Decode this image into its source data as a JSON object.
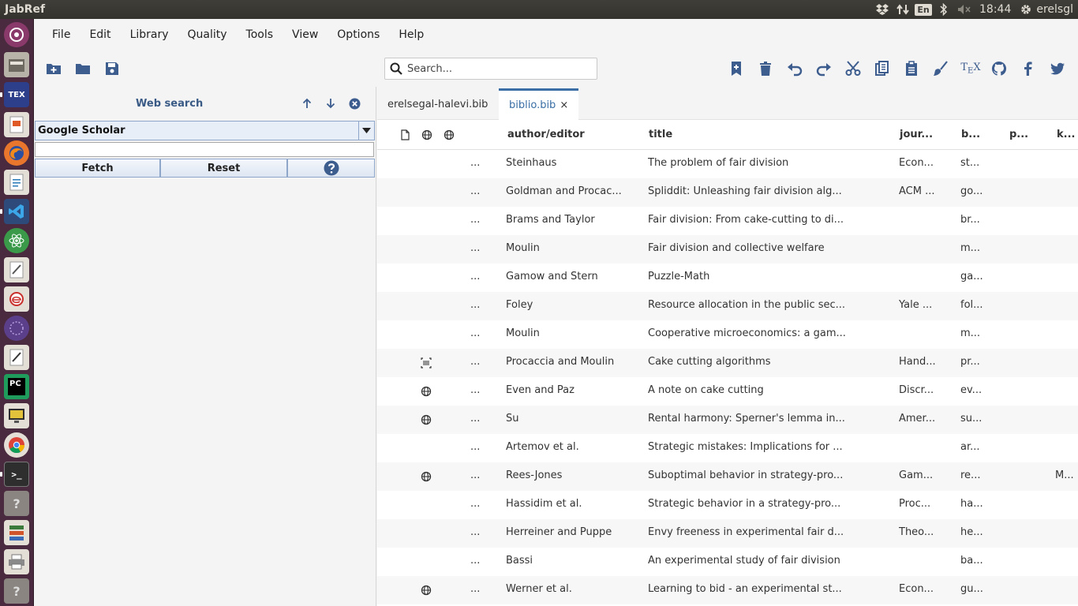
{
  "window": {
    "app_title": "JabRef"
  },
  "tray": {
    "lang": "En",
    "time": "18:44",
    "user": "erelsgl"
  },
  "menu": [
    "File",
    "Edit",
    "Library",
    "Quality",
    "Tools",
    "View",
    "Options",
    "Help"
  ],
  "search": {
    "placeholder": "Search..."
  },
  "web_search": {
    "title": "Web search",
    "fetcher": "Google Scholar",
    "query": "",
    "fetch_label": "Fetch",
    "reset_label": "Reset"
  },
  "tabs": [
    {
      "label": "erelsegal-halevi.bib",
      "active": false
    },
    {
      "label": "biblio.bib",
      "active": true,
      "close": "×"
    }
  ],
  "table": {
    "headers": {
      "author": "author/editor",
      "title": "title",
      "journal": "jour...",
      "bibkey": "b...",
      "pages": "p...",
      "keywords": "k..."
    },
    "rows": [
      {
        "icon": "",
        "more": "...",
        "author": "Steinhaus",
        "title": "The problem of fair division",
        "journal": "Econ...",
        "bibkey": "st...",
        "keywords": ""
      },
      {
        "icon": "",
        "more": "...",
        "author": "Goldman and Procac...",
        "title": "Spliddit: Unleashing fair division alg...",
        "journal": "ACM ...",
        "bibkey": "go...",
        "keywords": ""
      },
      {
        "icon": "",
        "more": "...",
        "author": "Brams and Taylor",
        "title": "Fair division: From cake-cutting to di...",
        "journal": "",
        "bibkey": "br...",
        "keywords": ""
      },
      {
        "icon": "",
        "more": "...",
        "author": "Moulin",
        "title": "Fair division and collective welfare",
        "journal": "",
        "bibkey": "m...",
        "keywords": ""
      },
      {
        "icon": "",
        "more": "...",
        "author": "Gamow and Stern",
        "title": "Puzzle-Math",
        "journal": "",
        "bibkey": "ga...",
        "keywords": ""
      },
      {
        "icon": "",
        "more": "...",
        "author": "Foley",
        "title": "Resource allocation in the public sec...",
        "journal": "Yale ...",
        "bibkey": "fol...",
        "keywords": ""
      },
      {
        "icon": "",
        "more": "...",
        "author": "Moulin",
        "title": "Cooperative microeconomics: a gam...",
        "journal": "",
        "bibkey": "m...",
        "keywords": ""
      },
      {
        "icon": "doi",
        "more": "...",
        "author": "Procaccia and Moulin",
        "title": "Cake cutting algorithms",
        "journal": "Hand...",
        "bibkey": "pr...",
        "keywords": ""
      },
      {
        "icon": "url",
        "more": "...",
        "author": "Even and Paz",
        "title": "A note on cake cutting",
        "journal": "Discr...",
        "bibkey": "ev...",
        "keywords": ""
      },
      {
        "icon": "url",
        "more": "...",
        "author": "Su",
        "title": "Rental harmony: Sperner's lemma in...",
        "journal": "Amer...",
        "bibkey": "su...",
        "keywords": ""
      },
      {
        "icon": "",
        "more": "...",
        "author": "Artemov et al.",
        "title": "Strategic mistakes: Implications for ...",
        "journal": "",
        "bibkey": "ar...",
        "keywords": ""
      },
      {
        "icon": "url",
        "more": "...",
        "author": "Rees-Jones",
        "title": "Suboptimal behavior in strategy-pro...",
        "journal": "Gam...",
        "bibkey": "re...",
        "keywords": "M..."
      },
      {
        "icon": "",
        "more": "...",
        "author": "Hassidim et al.",
        "title": "Strategic behavior in a strategy-pro...",
        "journal": "Proc...",
        "bibkey": "ha...",
        "keywords": ""
      },
      {
        "icon": "",
        "more": "...",
        "author": "Herreiner and Puppe",
        "title": "Envy freeness in experimental fair d...",
        "journal": "Theo...",
        "bibkey": "he...",
        "keywords": ""
      },
      {
        "icon": "",
        "more": "...",
        "author": "Bassi",
        "title": "An experimental study of fair division",
        "journal": "",
        "bibkey": "ba...",
        "keywords": ""
      },
      {
        "icon": "url",
        "more": "...",
        "author": "Werner et al.",
        "title": "Learning to bid - an experimental st...",
        "journal": "Econ...",
        "bibkey": "gu...",
        "keywords": ""
      }
    ]
  },
  "colors": {
    "accent": "#3d5d8f",
    "launcher_bg": "#4a2a3e",
    "panel_bg": "#f4f4f4"
  }
}
